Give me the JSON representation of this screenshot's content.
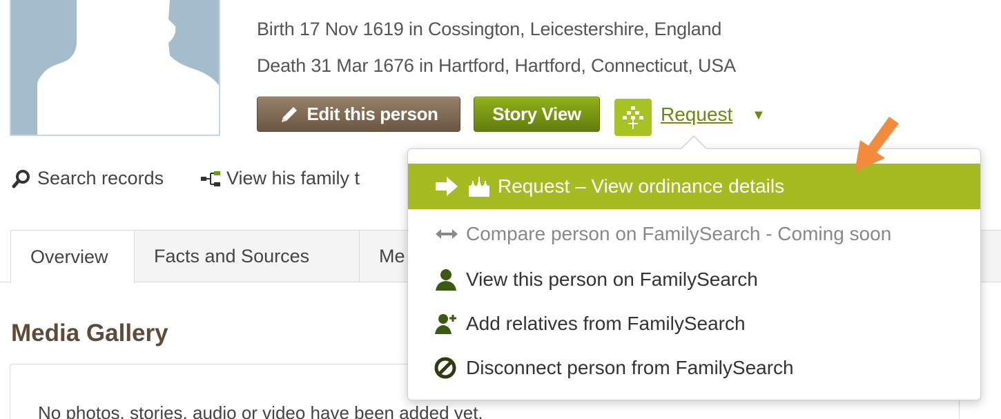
{
  "person": {
    "birth": "Birth 17 Nov 1619 in Cossington, Leicestershire, England",
    "death": "Death 31 Mar 1676 in Hartford, Hartford, Connecticut, USA"
  },
  "actions": {
    "edit_label": "Edit this person",
    "story_label": "Story View",
    "request_label": "Request",
    "request_caret": "▼"
  },
  "links": {
    "search": "Search records",
    "tree": "View his family t"
  },
  "tabs": [
    {
      "label": "Overview",
      "active": true
    },
    {
      "label": "Facts and Sources",
      "active": false
    },
    {
      "label": "Me",
      "active": false
    }
  ],
  "media": {
    "title": "Media Gallery",
    "empty": "No photos, stories, audio or video have been added yet."
  },
  "request_menu": {
    "items": [
      {
        "label": "Request – View ordinance details",
        "icon": "arrow-right-temple-icon",
        "state": "highlighted"
      },
      {
        "label": "Compare person on FamilySearch - Coming soon",
        "icon": "double-arrow-icon",
        "state": "disabled"
      },
      {
        "label": "View this person on FamilySearch",
        "icon": "person-icon",
        "state": "normal"
      },
      {
        "label": "Add relatives from FamilySearch",
        "icon": "add-person-icon",
        "state": "normal"
      },
      {
        "label": "Disconnect person from FamilySearch",
        "icon": "no-entry-icon",
        "state": "normal"
      }
    ]
  },
  "colors": {
    "accent_green": "#a6bb21",
    "link_green": "#6b8a0c",
    "brown_button": "#7d6851",
    "heading_brown": "#5d4b38",
    "callout_orange": "#f28c3c"
  }
}
